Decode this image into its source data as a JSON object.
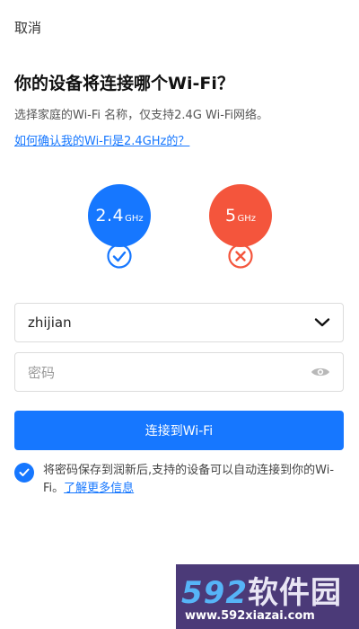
{
  "header": {
    "cancel_label": "取消"
  },
  "title": "你的设备将连接哪个Wi-Fi？",
  "subtitle": "选择家庭的Wi-Fi 名称，仅支持2.4G Wi-Fi网络。",
  "help_link": "如何确认我的Wi-Fi是2.4GHz的？",
  "bands": [
    {
      "value": "2.4",
      "unit": "GHz",
      "color": "#1677ff",
      "supported": true,
      "status_icon": "check-circle-icon"
    },
    {
      "value": "5",
      "unit": "GHz",
      "color": "#f4553c",
      "supported": false,
      "status_icon": "cross-circle-icon"
    }
  ],
  "form": {
    "ssid": {
      "value": "zhijian",
      "icon": "chevron-down-icon"
    },
    "password": {
      "placeholder": "密码",
      "icon": "eye-icon"
    },
    "connect_label": "连接到Wi-Fi"
  },
  "save": {
    "checked": true,
    "text": "将密码保存到润新后,支持的设备可以自动连接到你的Wi-Fi。",
    "link": "了解更多信息"
  },
  "watermark": {
    "logo_num": "592",
    "logo_text": "软件园",
    "url": "www.592xiazai.com"
  },
  "colors": {
    "accent": "#1677ff",
    "danger": "#f4553c"
  }
}
